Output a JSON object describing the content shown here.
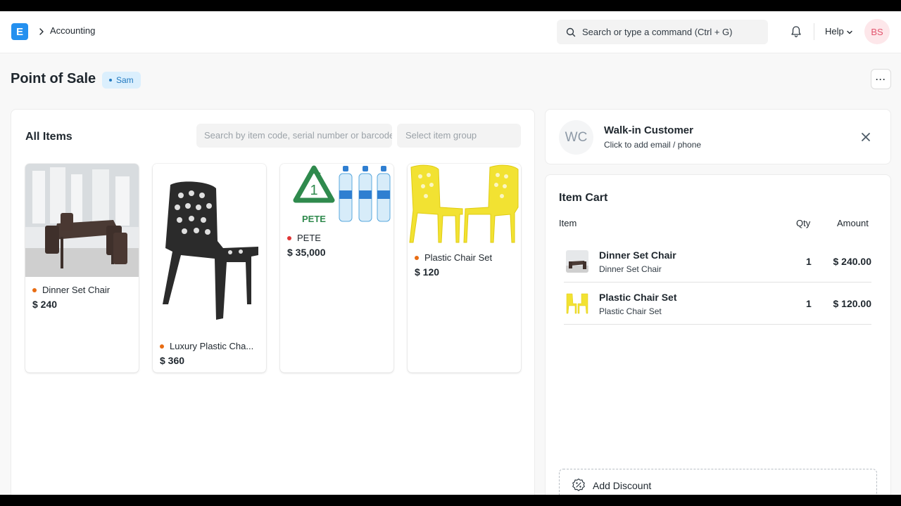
{
  "navbar": {
    "logo_letter": "E",
    "breadcrumb": "Accounting",
    "search_placeholder": "Search or type a command (Ctrl + G)",
    "help_label": "Help",
    "avatar_initials": "BS"
  },
  "page": {
    "title": "Point of Sale",
    "badge": "Sam",
    "more_label": "···"
  },
  "items": {
    "title": "All Items",
    "search_placeholder": "Search by item code, serial number or barcode",
    "group_placeholder": "Select item group",
    "list": [
      {
        "name": "Dinner Set Chair",
        "price": "$ 240"
      },
      {
        "name": "Luxury Plastic Cha...",
        "price": "$ 360"
      },
      {
        "name": "PETE",
        "price": "$ 35,000",
        "image_caption": "PETE",
        "image_number": "1"
      },
      {
        "name": "Plastic Chair Set",
        "price": "$ 120"
      }
    ]
  },
  "customer": {
    "initials": "WC",
    "name": "Walk-in Customer",
    "subtitle": "Click to add email / phone"
  },
  "cart": {
    "title": "Item Cart",
    "headers": {
      "item": "Item",
      "qty": "Qty",
      "amount": "Amount"
    },
    "rows": [
      {
        "name": "Dinner Set Chair",
        "description": "Dinner Set Chair",
        "qty": "1",
        "amount": "$ 240.00"
      },
      {
        "name": "Plastic Chair Set",
        "description": "Plastic Chair Set",
        "qty": "1",
        "amount": "$ 120.00"
      }
    ],
    "discount_label": "Add Discount"
  },
  "colors": {
    "accent": "#2490ef",
    "badge_bg": "#dbeffd",
    "indicator": "#e86c13",
    "avatar_bg": "#fde7ea"
  }
}
